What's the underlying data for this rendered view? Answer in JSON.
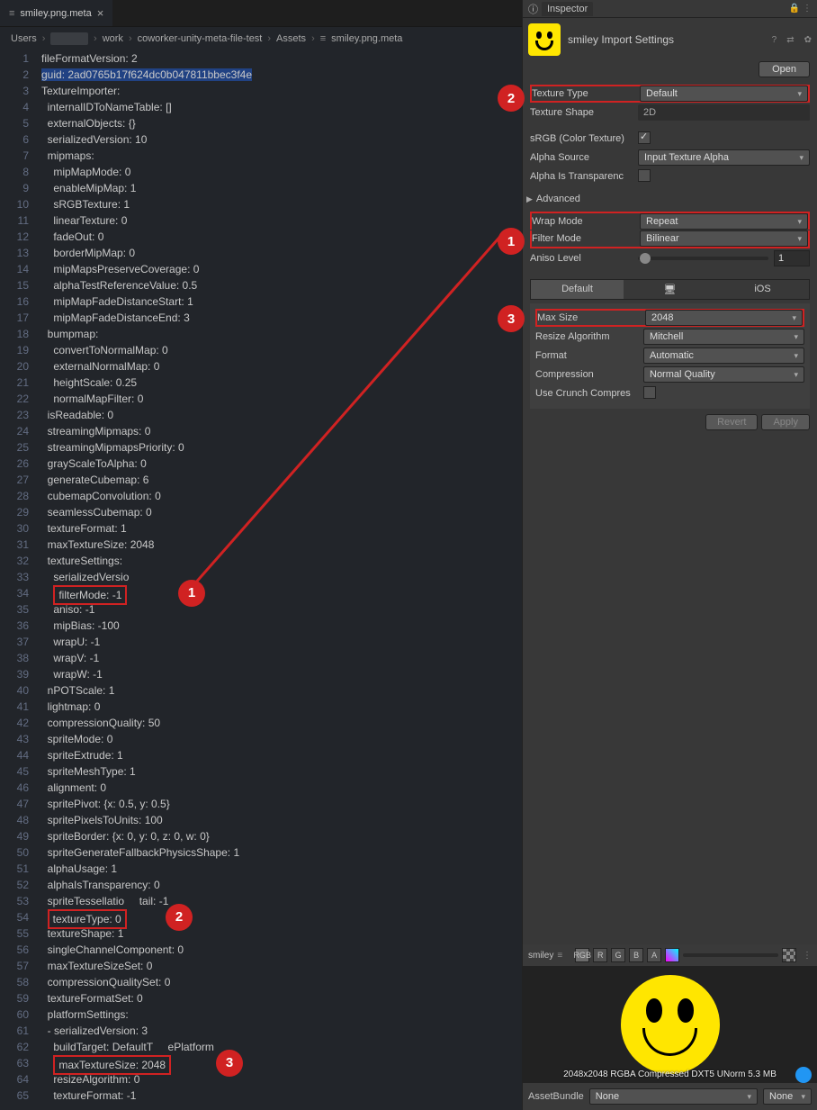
{
  "editor": {
    "tab_title": "smiley.png.meta",
    "breadcrumb": [
      "Users",
      "",
      "work",
      "coworker-unity-meta-file-test",
      "Assets",
      "smiley.png.meta"
    ],
    "code": [
      {
        "n": 1,
        "t": "fileFormatVersion: 2",
        "i": 0
      },
      {
        "n": 2,
        "t": "guid: 2ad0765b17f624dc0b047811bbec3f4e",
        "i": 0,
        "hl": true
      },
      {
        "n": 3,
        "t": "TextureImporter:",
        "i": 0
      },
      {
        "n": 4,
        "t": "internalIDToNameTable: []",
        "i": 1
      },
      {
        "n": 5,
        "t": "externalObjects: {}",
        "i": 1
      },
      {
        "n": 6,
        "t": "serializedVersion: 10",
        "i": 1
      },
      {
        "n": 7,
        "t": "mipmaps:",
        "i": 1
      },
      {
        "n": 8,
        "t": "mipMapMode: 0",
        "i": 2
      },
      {
        "n": 9,
        "t": "enableMipMap: 1",
        "i": 2
      },
      {
        "n": 10,
        "t": "sRGBTexture: 1",
        "i": 2
      },
      {
        "n": 11,
        "t": "linearTexture: 0",
        "i": 2
      },
      {
        "n": 12,
        "t": "fadeOut: 0",
        "i": 2
      },
      {
        "n": 13,
        "t": "borderMipMap: 0",
        "i": 2
      },
      {
        "n": 14,
        "t": "mipMapsPreserveCoverage: 0",
        "i": 2
      },
      {
        "n": 15,
        "t": "alphaTestReferenceValue: 0.5",
        "i": 2
      },
      {
        "n": 16,
        "t": "mipMapFadeDistanceStart: 1",
        "i": 2
      },
      {
        "n": 17,
        "t": "mipMapFadeDistanceEnd: 3",
        "i": 2
      },
      {
        "n": 18,
        "t": "bumpmap:",
        "i": 1
      },
      {
        "n": 19,
        "t": "convertToNormalMap: 0",
        "i": 2
      },
      {
        "n": 20,
        "t": "externalNormalMap: 0",
        "i": 2
      },
      {
        "n": 21,
        "t": "heightScale: 0.25",
        "i": 2
      },
      {
        "n": 22,
        "t": "normalMapFilter: 0",
        "i": 2
      },
      {
        "n": 23,
        "t": "isReadable: 0",
        "i": 1
      },
      {
        "n": 24,
        "t": "streamingMipmaps: 0",
        "i": 1
      },
      {
        "n": 25,
        "t": "streamingMipmapsPriority: 0",
        "i": 1
      },
      {
        "n": 26,
        "t": "grayScaleToAlpha: 0",
        "i": 1
      },
      {
        "n": 27,
        "t": "generateCubemap: 6",
        "i": 1
      },
      {
        "n": 28,
        "t": "cubemapConvolution: 0",
        "i": 1
      },
      {
        "n": 29,
        "t": "seamlessCubemap: 0",
        "i": 1
      },
      {
        "n": 30,
        "t": "textureFormat: 1",
        "i": 1
      },
      {
        "n": 31,
        "t": "maxTextureSize: 2048",
        "i": 1
      },
      {
        "n": 32,
        "t": "textureSettings:",
        "i": 1
      },
      {
        "n": 33,
        "t": "serializedVersio",
        "i": 2,
        "cut": true
      },
      {
        "n": 34,
        "t": "filterMode: -1",
        "i": 2,
        "box": 1
      },
      {
        "n": 35,
        "t": "aniso: -1",
        "i": 2
      },
      {
        "n": 36,
        "t": "mipBias: -100",
        "i": 2
      },
      {
        "n": 37,
        "t": "wrapU: -1",
        "i": 2
      },
      {
        "n": 38,
        "t": "wrapV: -1",
        "i": 2
      },
      {
        "n": 39,
        "t": "wrapW: -1",
        "i": 2
      },
      {
        "n": 40,
        "t": "nPOTScale: 1",
        "i": 1
      },
      {
        "n": 41,
        "t": "lightmap: 0",
        "i": 1
      },
      {
        "n": 42,
        "t": "compressionQuality: 50",
        "i": 1
      },
      {
        "n": 43,
        "t": "spriteMode: 0",
        "i": 1
      },
      {
        "n": 44,
        "t": "spriteExtrude: 1",
        "i": 1
      },
      {
        "n": 45,
        "t": "spriteMeshType: 1",
        "i": 1
      },
      {
        "n": 46,
        "t": "alignment: 0",
        "i": 1
      },
      {
        "n": 47,
        "t": "spritePivot: {x: 0.5, y: 0.5}",
        "i": 1
      },
      {
        "n": 48,
        "t": "spritePixelsToUnits: 100",
        "i": 1
      },
      {
        "n": 49,
        "t": "spriteBorder: {x: 0, y: 0, z: 0, w: 0}",
        "i": 1
      },
      {
        "n": 50,
        "t": "spriteGenerateFallbackPhysicsShape: 1",
        "i": 1
      },
      {
        "n": 51,
        "t": "alphaUsage: 1",
        "i": 1
      },
      {
        "n": 52,
        "t": "alphaIsTransparency: 0",
        "i": 1
      },
      {
        "n": 53,
        "t": "spriteTessellatio",
        "i": 1,
        "cut2": "tail: -1"
      },
      {
        "n": 54,
        "t": "textureType: 0",
        "i": 1,
        "box": 2
      },
      {
        "n": 55,
        "t": "textureShape: 1",
        "i": 1
      },
      {
        "n": 56,
        "t": "singleChannelComponent: 0",
        "i": 1
      },
      {
        "n": 57,
        "t": "maxTextureSizeSet: 0",
        "i": 1
      },
      {
        "n": 58,
        "t": "compressionQualitySet: 0",
        "i": 1
      },
      {
        "n": 59,
        "t": "textureFormatSet: 0",
        "i": 1
      },
      {
        "n": 60,
        "t": "platformSettings:",
        "i": 1
      },
      {
        "n": 61,
        "t": "- serializedVersion: 3",
        "i": 1
      },
      {
        "n": 62,
        "t": "buildTarget: DefaultT",
        "i": 2,
        "cut3": "ePlatform"
      },
      {
        "n": 63,
        "t": "maxTextureSize: 2048",
        "i": 2,
        "box": 3
      },
      {
        "n": 64,
        "t": "resizeAlgorithm: 0",
        "i": 2
      },
      {
        "n": 65,
        "t": "textureFormat: -1",
        "i": 2
      }
    ]
  },
  "inspector": {
    "tab": "Inspector",
    "title": "smiley Import Settings",
    "open": "Open",
    "texture_type": {
      "lbl": "Texture Type",
      "val": "Default"
    },
    "texture_shape": {
      "lbl": "Texture Shape",
      "val": "2D"
    },
    "srgb": {
      "lbl": "sRGB (Color Texture)",
      "val": true
    },
    "alpha_source": {
      "lbl": "Alpha Source",
      "val": "Input Texture Alpha"
    },
    "alpha_trans": {
      "lbl": "Alpha Is Transparenc",
      "val": false
    },
    "advanced": "Advanced",
    "wrap": {
      "lbl": "Wrap Mode",
      "val": "Repeat"
    },
    "filter": {
      "lbl": "Filter Mode",
      "val": "Bilinear"
    },
    "aniso": {
      "lbl": "Aniso Level",
      "val": "1"
    },
    "ptabs": [
      "Default",
      "",
      ""
    ],
    "ios": "iOS",
    "max_size": {
      "lbl": "Max Size",
      "val": "2048"
    },
    "resize": {
      "lbl": "Resize Algorithm",
      "val": "Mitchell"
    },
    "format": {
      "lbl": "Format",
      "val": "Automatic"
    },
    "compression": {
      "lbl": "Compression",
      "val": "Normal Quality"
    },
    "crunch": {
      "lbl": "Use Crunch Compres",
      "val": false
    },
    "revert": "Revert",
    "apply": "Apply",
    "preview_name": "smiley",
    "channels": [
      "RGB",
      "R",
      "G",
      "B",
      "A"
    ],
    "preview_caption": "2048x2048  RGBA Compressed DXT5 UNorm   5.3 MB",
    "bundle_lbl": "AssetBundle",
    "bundle_val": "None",
    "bundle_variant": "None"
  },
  "callouts": {
    "1": "1",
    "2": "2",
    "3": "3"
  }
}
